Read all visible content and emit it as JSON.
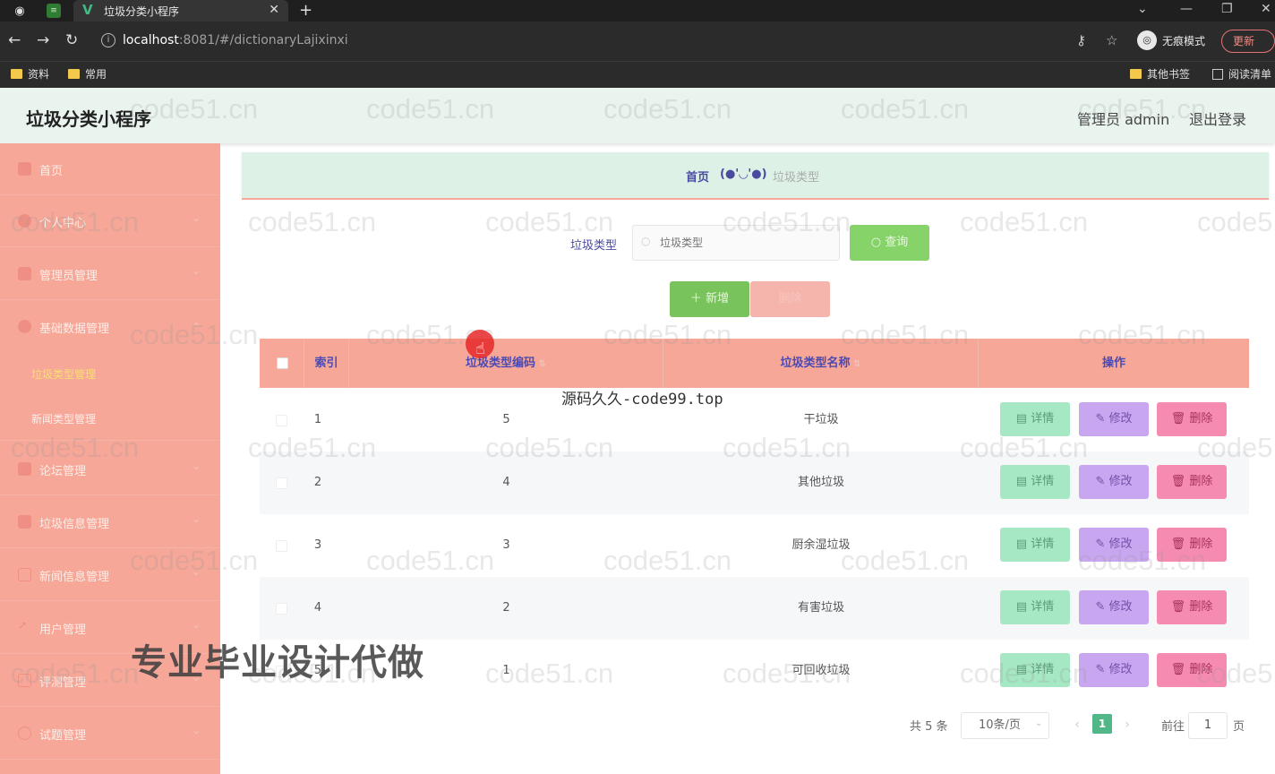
{
  "browser": {
    "tab_title": "垃圾分类小程序",
    "url_host": "localhost",
    "url_rest": ":8081/#/dictionaryLajixinxi",
    "profile_label": "无痕模式",
    "update_label": "更新",
    "bookmarks": [
      "资料",
      "常用"
    ],
    "bookmarks_right": [
      "其他书签",
      "阅读清单"
    ]
  },
  "header": {
    "title": "垃圾分类小程序",
    "admin": "管理员 admin",
    "logout": "退出登录"
  },
  "sidebar": {
    "items": [
      {
        "label": "首页",
        "icon": "home-icon"
      },
      {
        "label": "个人中心",
        "icon": "user-icon"
      },
      {
        "label": "管理员管理",
        "icon": "card-icon"
      },
      {
        "label": "基础数据管理",
        "icon": "users-icon"
      },
      {
        "label": "论坛管理",
        "icon": "forum-icon"
      },
      {
        "label": "垃圾信息管理",
        "icon": "trash-icon"
      },
      {
        "label": "新闻信息管理",
        "icon": "news-icon"
      },
      {
        "label": "用户管理",
        "icon": "send-icon"
      },
      {
        "label": "评测管理",
        "icon": "mail-icon"
      },
      {
        "label": "试题管理",
        "icon": "clock-icon"
      }
    ],
    "subitems": [
      {
        "label": "垃圾类型管理",
        "active": true
      },
      {
        "label": "新闻类型管理",
        "active": false
      }
    ]
  },
  "breadcrumb": {
    "home": "首页",
    "face": "(●'◡'●)",
    "current": "垃圾类型"
  },
  "search": {
    "label": "垃圾类型",
    "placeholder": "垃圾类型",
    "button": "查询"
  },
  "actions": {
    "add": "新增",
    "batch_delete": "删除"
  },
  "table": {
    "headers": [
      "索引",
      "垃圾类型编码",
      "垃圾类型名称",
      "操作"
    ],
    "rows": [
      {
        "index": "1",
        "code": "5",
        "name": "干垃圾"
      },
      {
        "index": "2",
        "code": "4",
        "name": "其他垃圾"
      },
      {
        "index": "3",
        "code": "3",
        "name": "厨余湿垃圾"
      },
      {
        "index": "4",
        "code": "2",
        "name": "有害垃圾"
      },
      {
        "index": "5",
        "code": "1",
        "name": "可回收垃圾"
      }
    ],
    "row_actions": {
      "detail": "详情",
      "edit": "修改",
      "delete": "删除"
    }
  },
  "pagination": {
    "total": "共 5 条",
    "page_size": "10条/页",
    "current_page": "1",
    "goto_label": "前往",
    "goto_value": "1",
    "page_unit": "页"
  },
  "overlay": {
    "watermark": "code51.cn",
    "center_text": "源码久久-code99.top",
    "big_text": "专业毕业设计代做"
  },
  "colors": {
    "sidebar": "#f7a798",
    "header": "#eaf4ef",
    "accent_green": "#86d36a",
    "table_head": "#f7a798"
  }
}
